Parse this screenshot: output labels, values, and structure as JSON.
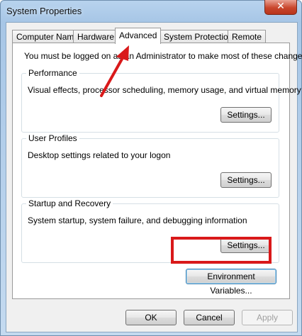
{
  "window": {
    "title": "System Properties",
    "close_glyph": "✕"
  },
  "tabs": [
    {
      "label": "Computer Name",
      "active": false
    },
    {
      "label": "Hardware",
      "active": false
    },
    {
      "label": "Advanced",
      "active": true
    },
    {
      "label": "System Protection",
      "active": false
    },
    {
      "label": "Remote",
      "active": false
    }
  ],
  "advanced": {
    "admin_note": "You must be logged on as an Administrator to make most of these changes.",
    "groups": {
      "performance": {
        "title": "Performance",
        "description": "Visual effects, processor scheduling, memory usage, and virtual memory",
        "button": "Settings..."
      },
      "user_profiles": {
        "title": "User Profiles",
        "description": "Desktop settings related to your logon",
        "button": "Settings..."
      },
      "startup_recovery": {
        "title": "Startup and Recovery",
        "description": "System startup, system failure, and debugging information",
        "button": "Settings..."
      }
    },
    "env_button": "Environment Variables..."
  },
  "footer": {
    "ok": "OK",
    "cancel": "Cancel",
    "apply": "Apply"
  },
  "annotations": {
    "highlight_color": "#d9191a",
    "arrow_color": "#d9191a"
  }
}
